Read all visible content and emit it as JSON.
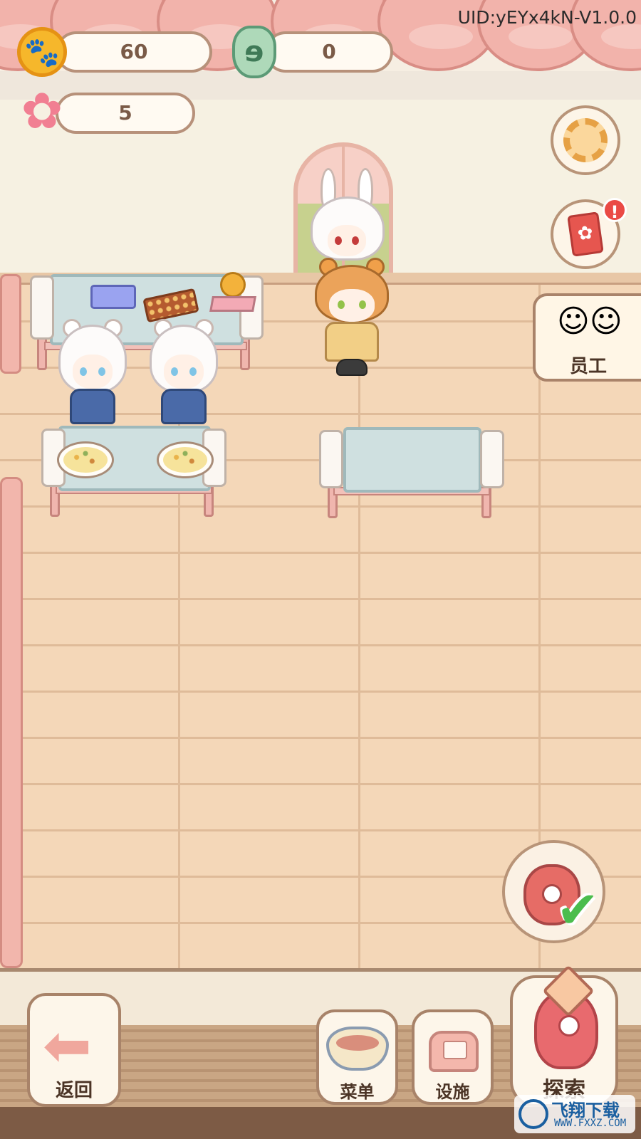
{
  "hud": {
    "uid": "UID:yEYx4kN-V1.0.0",
    "coins": "60",
    "jade": "0",
    "sakura": "5"
  },
  "side": {
    "staff_label": "员工",
    "cards_badge": "!"
  },
  "bottom": {
    "back_label": "返回",
    "menu_label": "菜单",
    "facility_label": "设施",
    "explore_label": "探索"
  },
  "watermark": {
    "brand": "飞翔下载",
    "site": "WWW.FXXZ.COM"
  },
  "colors": {
    "coin": "#f6b72b",
    "jade": "#aed9b9",
    "sakura": "#f17f92",
    "check": "#4bbd4d",
    "badge": "#ea4a45"
  },
  "icons": {
    "coin": "paw-coin-icon",
    "jade": "jade-dragon-icon",
    "sakura": "sakura-icon",
    "settings": "gear-icon",
    "cards": "cards-icon",
    "staff": "staff-faces-icon",
    "back": "left-arrow-icon",
    "menu": "noodle-bowl-icon",
    "facility": "sofa-icon",
    "explore": "monster-icon",
    "order_done": "check-icon"
  }
}
